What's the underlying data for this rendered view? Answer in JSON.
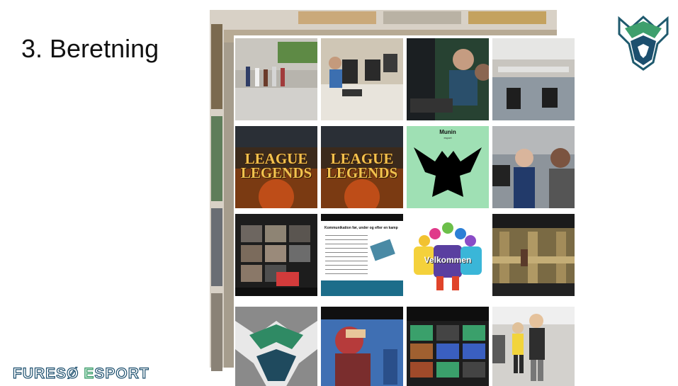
{
  "slide": {
    "title": "3. Beretning",
    "brand": {
      "first": "FURESØ ",
      "second_initial": "E",
      "second_rest": "SPORT"
    }
  },
  "tiles": {
    "league_text_1": "LEAGUE",
    "league_text_2": "LEGENDS",
    "munin_title": "Munin",
    "munin_sub": "esport",
    "doc_title": "Kommunikation før, under og efter en kamp",
    "velkommen": "Velkommen"
  },
  "colors": {
    "accent_teal": "#1c4f6e",
    "accent_green": "#3d9a6b",
    "munin_bg": "#9fe0b4"
  }
}
